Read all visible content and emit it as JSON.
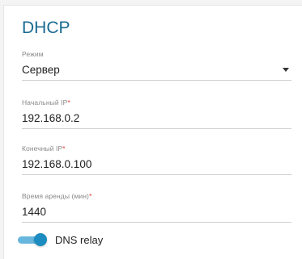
{
  "section": {
    "title": "DHCP"
  },
  "mode": {
    "label": "Режим",
    "value": "Сервер"
  },
  "start_ip": {
    "label": "Начальный IP",
    "required_mark": "*",
    "value": "192.168.0.2"
  },
  "end_ip": {
    "label": "Конечный IP",
    "required_mark": "*",
    "value": "192.168.0.100"
  },
  "lease_time": {
    "label": "Время аренды (мин)",
    "required_mark": "*",
    "value": "1440"
  },
  "dns_relay": {
    "label": "DNS relay",
    "enabled": true
  },
  "colors": {
    "accent": "#1c8cc1",
    "title": "#1a6a92",
    "required": "#e53935"
  },
  "icons": {
    "mode_dropdown": "caret-down-icon"
  }
}
